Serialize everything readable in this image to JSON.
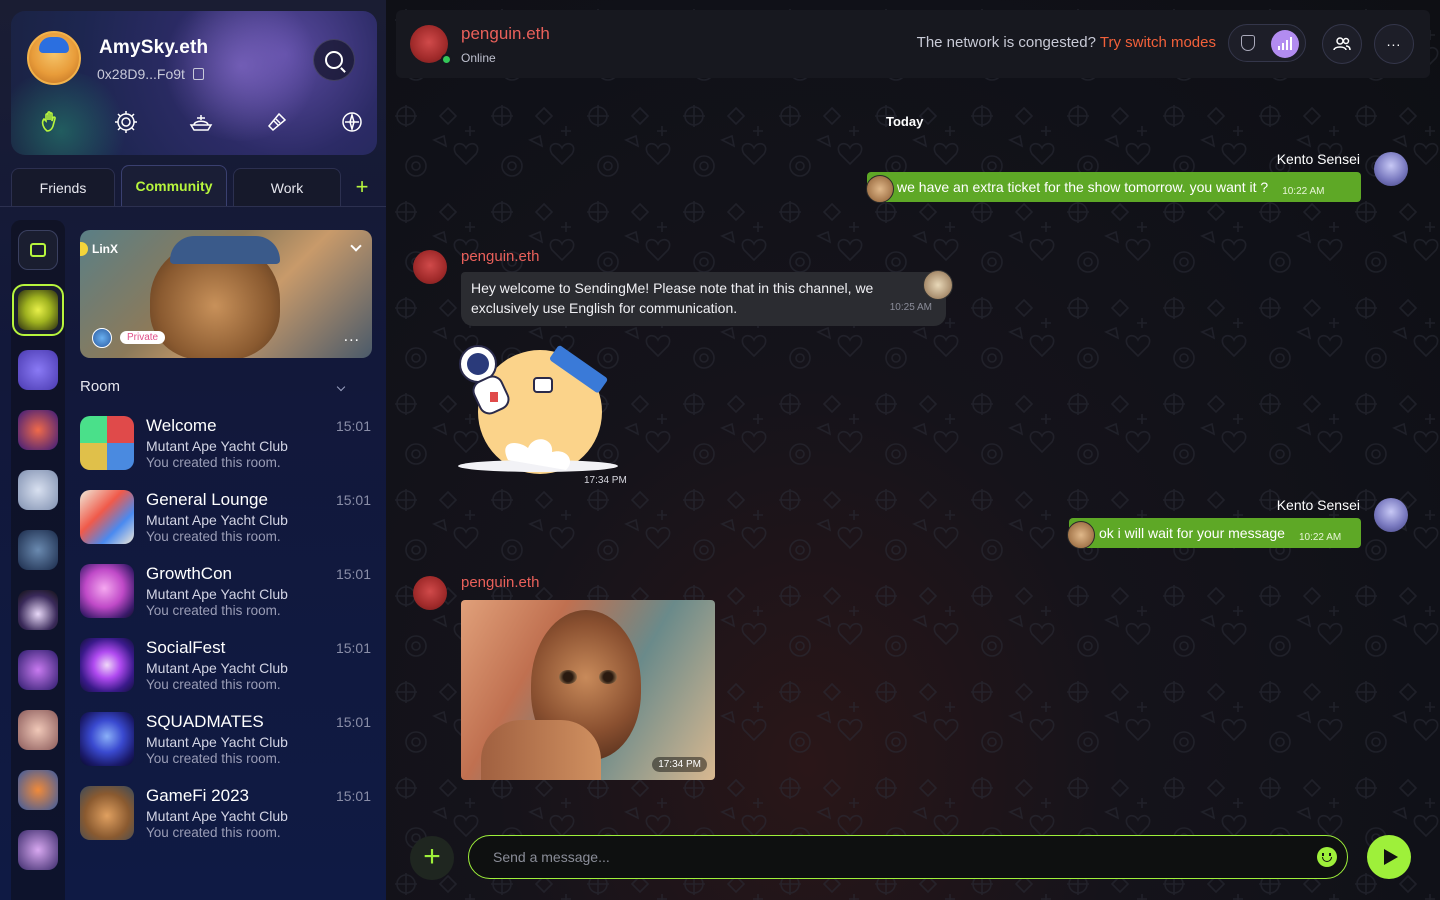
{
  "profile": {
    "name": "AmySky.eth",
    "wallet": "0x28D9...Fo9t"
  },
  "tabs": {
    "friends": "Friends",
    "community": "Community",
    "work": "Work",
    "add": "+"
  },
  "banner": {
    "label": "LinX",
    "privacy": "Private",
    "more": "..."
  },
  "room_section": {
    "title": "Room"
  },
  "rooms": [
    {
      "name": "Welcome",
      "sub": "Mutant Ape Yacht Club",
      "note": "You created this room.",
      "time": "15:01"
    },
    {
      "name": "General Lounge",
      "sub": "Mutant Ape Yacht Club",
      "note": "You created this room.",
      "time": "15:01"
    },
    {
      "name": "GrowthCon",
      "sub": "Mutant Ape Yacht Club",
      "note": "You created this room.",
      "time": "15:01"
    },
    {
      "name": "SocialFest",
      "sub": "Mutant Ape Yacht Club",
      "note": "You created this room.",
      "time": "15:01"
    },
    {
      "name": "SQUADMATES",
      "sub": "Mutant Ape Yacht Club",
      "note": "You created this room.",
      "time": "15:01"
    },
    {
      "name": "GameFi 2023",
      "sub": "Mutant Ape Yacht Club",
      "note": "You created this room.",
      "time": "15:01"
    }
  ],
  "chat_header": {
    "name": "penguin.eth",
    "status": "Online",
    "network_text": "The network is congested?",
    "network_link": "Try switch modes"
  },
  "chat": {
    "date_separator": "Today",
    "messages": [
      {
        "sender": "Kento Sensei",
        "text": "we have an extra ticket for the show tomorrow. you want it ?",
        "time": "10:22 AM"
      },
      {
        "sender": "penguin.eth",
        "text": "Hey welcome to SendingMe! Please note that in this channel, we exclusively use English for communication.",
        "time": "10:25 AM"
      },
      {
        "sender": "",
        "text": "",
        "time": "17:34 PM"
      },
      {
        "sender": "Kento Sensei",
        "text": "ok i will wait for your message",
        "time": "10:22 AM"
      },
      {
        "sender": "penguin.eth",
        "text": "",
        "time": "17:34 PM"
      }
    ]
  },
  "composer": {
    "placeholder": "Send a message..."
  },
  "colors": {
    "accent": "#9ef03a",
    "community_tab": "#b7f53d",
    "sender_name": "#e9605a",
    "outgoing_bubble": "#5ea826",
    "incoming_bubble": "#2b2c31",
    "link": "#f2603a"
  },
  "icons": {
    "profile_quick": [
      "hand-icon",
      "settings-gear-icon",
      "ship-icon",
      "ticket-icon",
      "compass-icon"
    ],
    "header": [
      "shield-icon",
      "signal-icon",
      "users-icon",
      "more-icon"
    ]
  }
}
